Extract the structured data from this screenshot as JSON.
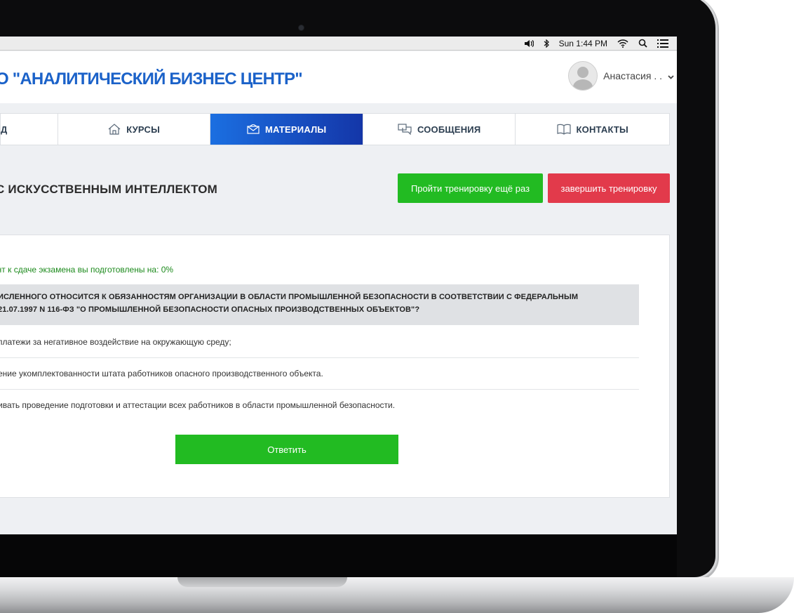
{
  "menubar": {
    "volume_icon": "speaker-icon",
    "bluetooth_icon": "bluetooth-icon",
    "clock": "Sun 1:44 PM",
    "wifi_icon": "wifi-icon",
    "search_icon": "spotlight-icon",
    "menu_icon": "list-icon"
  },
  "header": {
    "org_name": "О \"АНАЛИТИЧЕСКИЙ БИЗНЕС ЦЕНТР\"",
    "user_name": "Анастасия . .",
    "brand_color": "#1b62c9"
  },
  "nav": {
    "items": [
      {
        "label": "Д",
        "icon": ""
      },
      {
        "label": "КУРСЫ",
        "icon": "home-icon"
      },
      {
        "label": "МАТЕРИАЛЫ",
        "icon": "envelope-icon"
      },
      {
        "label": "СООБЩЕНИЯ",
        "icon": "chat-icon"
      },
      {
        "label": "КОНТАКТЫ",
        "icon": "book-icon"
      }
    ],
    "active_index": 2,
    "active_color": "#1b6fe1"
  },
  "main": {
    "title": "С ИСКУССТВЕННЫМ ИНТЕЛЛЕКТОМ",
    "retry_label": "Пройти тренировку ещё раз",
    "finish_label": "завершить тренировку",
    "progress_text": "ент к сдаче экзамена вы подготовлены на: 0%",
    "question_line1": "ИСЛЕННОГО ОТНОСИТСЯ К ОБЯЗАННОСТЯМ ОРГАНИЗАЦИИ В ОБЛАСТИ ПРОМЫШЛЕННОЙ БЕЗОПАСНОСТИ В СООТВЕТСТВИИ С ФЕДЕРАЛЬНЫМ",
    "question_line2": "21.07.1997 N 116-ФЗ \"О ПРОМЫШЛЕННОЙ БЕЗОПАСНОСТИ ОПАСНЫХ ПРОИЗВОДСТВЕННЫХ ОБЪЕКТОВ\"?",
    "answers": [
      "платежи за негативное воздействие на окружающую среду;",
      "ение укомплектованности штата работников опасного производственного объекта.",
      "ивать проведение подготовки и аттестации всех работников в области промышленной безопасности."
    ],
    "submit_label": "Ответить",
    "green": "#22bb22",
    "red": "#e23a4b"
  }
}
